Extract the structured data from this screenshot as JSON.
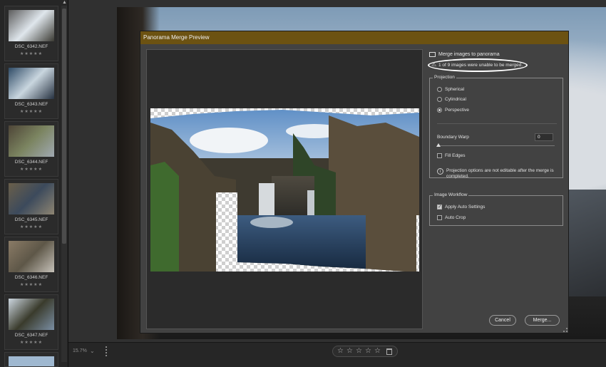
{
  "filmstrip": {
    "thumbnails": [
      {
        "name": "DSC_6342.NEF",
        "stars": "★★★★★",
        "colors": [
          "#5c5c5c",
          "#dfe6ec",
          "#3b3a33"
        ]
      },
      {
        "name": "DSC_6343.NEF",
        "stars": "★★★★★",
        "colors": [
          "#2f4b66",
          "#c9d6df",
          "#263140"
        ]
      },
      {
        "name": "DSC_6344.NEF",
        "stars": "★★★★★",
        "colors": [
          "#4e4537",
          "#7b8460",
          "#a0a9b2"
        ]
      },
      {
        "name": "DSC_6345.NEF",
        "stars": "★★★★★",
        "colors": [
          "#6a5f4a",
          "#3c4a5c",
          "#8e8572"
        ]
      },
      {
        "name": "DSC_6346.NEF",
        "stars": "★★★★★",
        "colors": [
          "#8a7b66",
          "#5e5748",
          "#c6c2b9"
        ]
      },
      {
        "name": "DSC_6347.NEF",
        "stars": "★★★★★",
        "colors": [
          "#cdd7e0",
          "#3a3b2c",
          "#7a8ea3"
        ]
      }
    ],
    "partial_thumb_color": "#9fb8d0"
  },
  "bottombar": {
    "zoom": "15.7%",
    "zoom_caret": "⌄",
    "rating_stars": [
      "☆",
      "☆",
      "☆",
      "☆",
      "☆"
    ]
  },
  "dialog": {
    "title": "Panorama Merge Preview",
    "title_bar_color": "#6c5211",
    "header_label": "Merge images to panorama",
    "warning_text": "1 of 9 images were unable to be merged.",
    "warning_icon": "⚠",
    "projection": {
      "group_title": "Projection",
      "options": [
        {
          "label": "Spherical",
          "selected": false
        },
        {
          "label": "Cylindrical",
          "selected": false
        },
        {
          "label": "Perspective",
          "selected": true
        }
      ],
      "boundary_warp_label": "Boundary Warp",
      "boundary_warp_value": "0",
      "fill_edges_label": "Fill Edges",
      "fill_edges_checked": false,
      "info_icon": "i",
      "info_text": "Projection options are not editable after the merge is completed."
    },
    "workflow": {
      "group_title": "Image Workflow",
      "apply_auto_settings_label": "Apply Auto Settings",
      "apply_auto_settings_checked": true,
      "auto_crop_label": "Auto Crop",
      "auto_crop_checked": false
    },
    "cancel_label": "Cancel",
    "merge_label": "Merge..."
  }
}
